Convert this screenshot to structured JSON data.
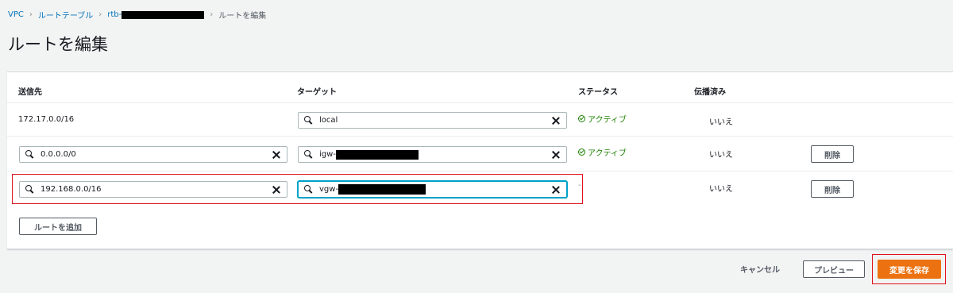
{
  "breadcrumb": {
    "vpc": "VPC",
    "route_tables": "ルートテーブル",
    "rtb_prefix": "rtb-",
    "current": "ルートを編集"
  },
  "page_title": "ルートを編集",
  "table": {
    "headers": {
      "destination": "送信先",
      "target": "ターゲット",
      "status": "ステータス",
      "propagated": "伝播済み"
    },
    "rows": [
      {
        "destination": "172.17.0.0/16",
        "target": "local",
        "status": "アクティブ",
        "propagated": "いいえ"
      },
      {
        "destination": "0.0.0.0/0",
        "target_prefix": "igw-",
        "status": "アクティブ",
        "propagated": "いいえ",
        "remove_label": "削除"
      },
      {
        "destination": "192.168.0.0/16",
        "target_prefix": "vgw-",
        "status": "-",
        "propagated": "いいえ",
        "remove_label": "削除"
      }
    ],
    "add_route_label": "ルートを追加"
  },
  "footer": {
    "cancel_label": "キャンセル",
    "preview_label": "プレビュー",
    "save_label": "変更を保存"
  },
  "colors": {
    "accent_orange": "#ec7211",
    "status_green": "#1d8102",
    "link_blue": "#0073bb",
    "highlight_red": "#e0111c"
  },
  "icons": [
    "search-icon",
    "clear-icon",
    "status-success-icon",
    "chevron-right-icon"
  ]
}
